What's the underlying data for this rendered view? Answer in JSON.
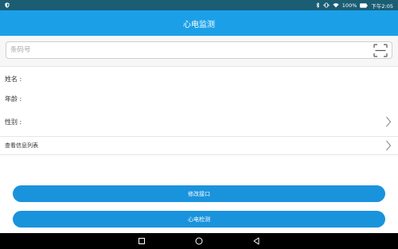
{
  "status_bar": {
    "battery": "100%",
    "time": "下午2:05",
    "icons": [
      "shield-icon",
      "bluetooth-icon",
      "vibrate-icon",
      "wifi-icon",
      "battery-icon"
    ]
  },
  "app_bar": {
    "title": "心电监测"
  },
  "search": {
    "placeholder": "条码号",
    "value": ""
  },
  "patient": {
    "name_label": "姓名 :",
    "age_label": "年龄 :",
    "gender_label": "性别 :"
  },
  "list_link": {
    "label": "查看信息列表"
  },
  "buttons": {
    "modify_label": "修改接口",
    "ecg_label": "心电检测"
  },
  "colors": {
    "status_bar": "#1b5d73",
    "app_bar": "#1ba0e8",
    "button": "#1a93dd",
    "nav_bar": "#000000"
  }
}
